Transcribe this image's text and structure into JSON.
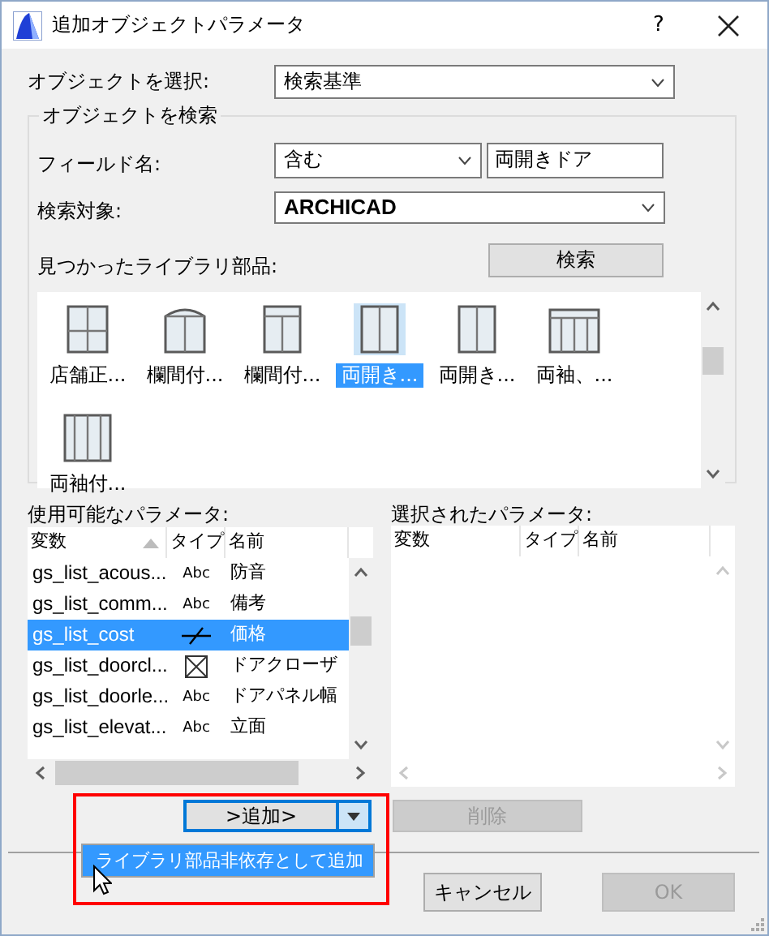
{
  "window": {
    "title": "追加オブジェクトパラメータ",
    "help": "?"
  },
  "select_object": {
    "label": "オブジェクトを選択:",
    "value": "検索基準"
  },
  "search_group": {
    "title": "オブジェクトを検索",
    "field_label": "フィールド名:",
    "condition": "含む",
    "field_value": "両開きドア",
    "target_label": "検索対象:",
    "target": "ARCHICAD",
    "found_label": "見つかったライブラリ部品:",
    "search_button": "検索"
  },
  "library_items": [
    {
      "label": "店舗正...",
      "kind": "grid",
      "selected": false
    },
    {
      "label": "欄間付...",
      "kind": "arch",
      "selected": false
    },
    {
      "label": "欄間付...",
      "kind": "transom",
      "selected": false
    },
    {
      "label": "両開き...",
      "kind": "double",
      "selected": true
    },
    {
      "label": "両開き...",
      "kind": "double",
      "selected": false
    },
    {
      "label": "両袖、...",
      "kind": "sidelite-transom",
      "selected": false
    },
    {
      "label": "両袖付...",
      "kind": "sidelite",
      "selected": false
    }
  ],
  "available_parameters": {
    "label": "使用可能なパラメータ:",
    "columns": [
      "変数",
      "タイプ",
      "名前"
    ],
    "rows": [
      {
        "variable": "gs_list_acous...",
        "type": {
          "kind": "text",
          "label": "Abc"
        },
        "name": "防音",
        "selected": false
      },
      {
        "variable": "gs_list_comm...",
        "type": {
          "kind": "text",
          "label": "Abc"
        },
        "name": "備考",
        "selected": false
      },
      {
        "variable": "gs_list_cost",
        "type": {
          "kind": "price"
        },
        "name": "価格",
        "selected": true
      },
      {
        "variable": "gs_list_doorcl...",
        "type": {
          "kind": "boolean"
        },
        "name": "ドアクローザ",
        "selected": false
      },
      {
        "variable": "gs_list_doorle...",
        "type": {
          "kind": "text",
          "label": "Abc"
        },
        "name": "ドアパネル幅",
        "selected": false
      },
      {
        "variable": "gs_list_elevat...",
        "type": {
          "kind": "text",
          "label": "Abc"
        },
        "name": "立面",
        "selected": false
      }
    ]
  },
  "selected_parameters": {
    "label": "選択されたパラメータ:",
    "columns": [
      "変数",
      "タイプ",
      "名前"
    ]
  },
  "add_button": {
    "label": ">追加>"
  },
  "add_menu": [
    {
      "label": "ライブラリ部品非依存として追加",
      "selected": true
    }
  ],
  "delete_button": {
    "label": "削除",
    "disabled": true
  },
  "cancel_button": {
    "label": "キャンセル",
    "disabled": false
  },
  "ok_button": {
    "label": "OK",
    "disabled": true
  }
}
